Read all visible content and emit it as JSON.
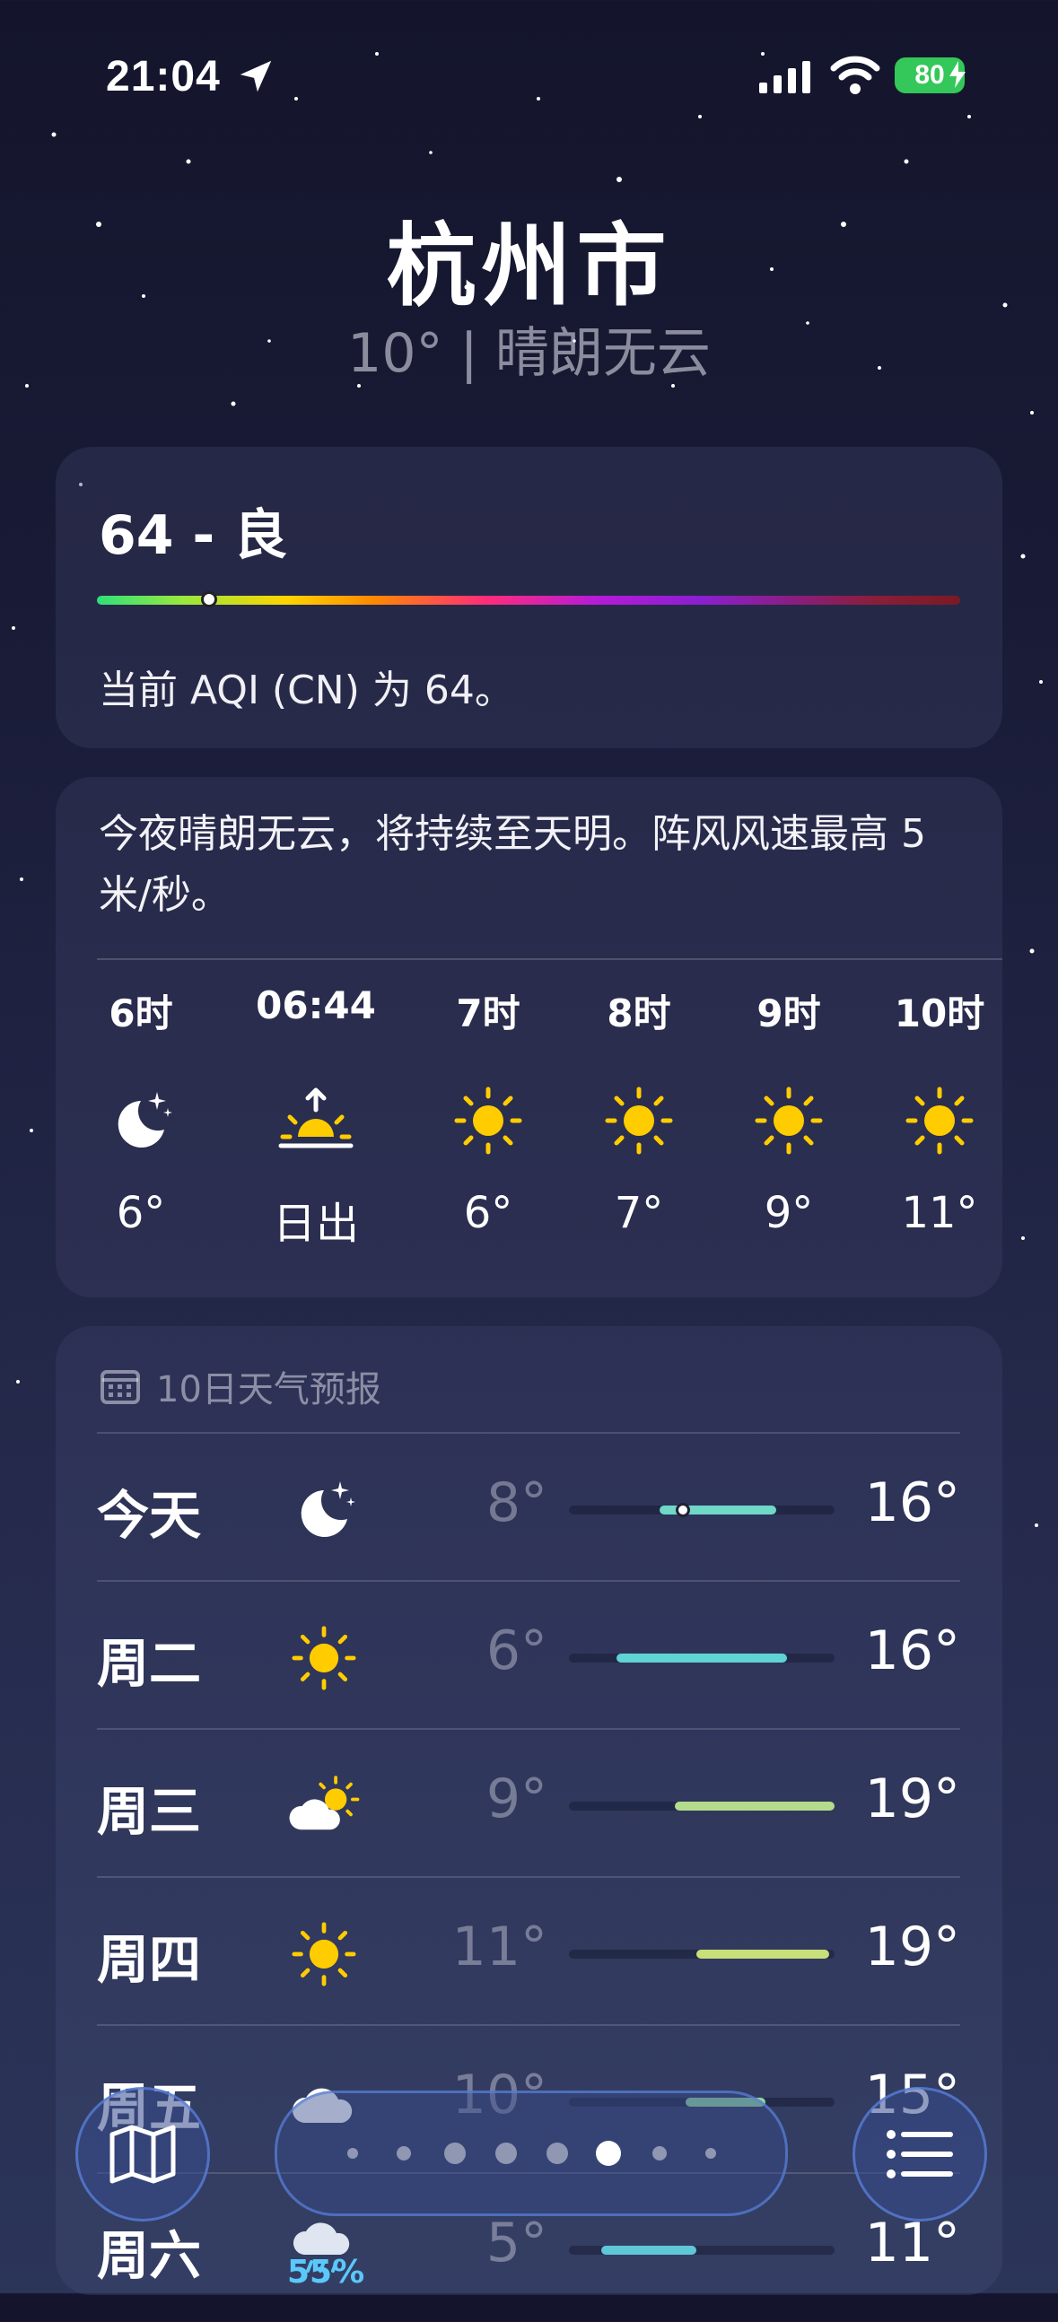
{
  "status_bar": {
    "time": "21:04",
    "battery": "80"
  },
  "header": {
    "city": "杭州市",
    "current": "10° | 晴朗无云"
  },
  "aqi": {
    "value": "64 - 良",
    "description": "当前 AQI (CN) 为 64。",
    "level": 0.13
  },
  "hourly": {
    "summary": "今夜晴朗无云，将持续至天明。阵风风速最高 5 米/秒。",
    "items": [
      {
        "label": "6时",
        "icon": "moon-stars-icon",
        "temp": "6°"
      },
      {
        "label": "06:44",
        "icon": "sunrise-icon",
        "temp": "日出"
      },
      {
        "label": "7时",
        "icon": "sun-icon",
        "temp": "6°"
      },
      {
        "label": "8时",
        "icon": "sun-icon",
        "temp": "7°"
      },
      {
        "label": "9时",
        "icon": "sun-icon",
        "temp": "9°"
      },
      {
        "label": "10时",
        "icon": "sun-icon",
        "temp": "11°"
      }
    ]
  },
  "forecast": {
    "title": "10日天气预报",
    "rows": [
      {
        "day": "今天",
        "icon": "moon-stars-icon",
        "low": "8°",
        "high": "16°",
        "bar_from": 0.34,
        "bar_to": 0.78,
        "current": 0.43,
        "color": "#6fd8c8"
      },
      {
        "day": "周二",
        "icon": "sun-icon",
        "low": "6°",
        "high": "16°",
        "bar_from": 0.18,
        "bar_to": 0.82,
        "color": "#5fd3d5"
      },
      {
        "day": "周三",
        "icon": "cloud-sun-icon",
        "low": "9°",
        "high": "19°",
        "bar_from": 0.4,
        "bar_to": 1.0,
        "color": "#b3dc8c"
      },
      {
        "day": "周四",
        "icon": "sun-icon",
        "low": "11°",
        "high": "19°",
        "bar_from": 0.48,
        "bar_to": 0.98,
        "color": "#c9df7a"
      },
      {
        "day": "周五",
        "icon": "cloud-icon",
        "low": "10°",
        "high": "15°",
        "bar_from": 0.44,
        "bar_to": 0.74,
        "color": "#8fd6a0"
      },
      {
        "day": "周六",
        "icon": "cloud-rain-icon",
        "low": "5°",
        "high": "11°",
        "bar_from": 0.12,
        "bar_to": 0.48,
        "color": "#5fc7d8",
        "precip": "55%"
      }
    ]
  },
  "toolbar": {
    "page_count": 8,
    "active_page": 5
  },
  "colors": {
    "sun": "#ffcc00",
    "accent": "#5ac8fa",
    "battery": "#34c759"
  }
}
